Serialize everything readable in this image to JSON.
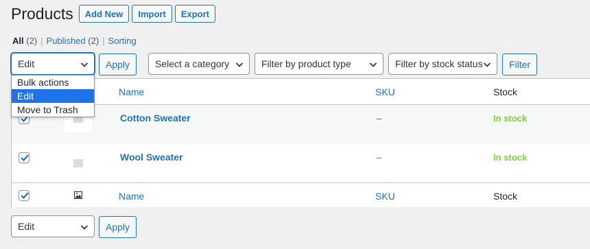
{
  "header": {
    "title": "Products",
    "buttons": [
      "Add New",
      "Import",
      "Export"
    ]
  },
  "views": [
    {
      "label": "All",
      "count": "(2)"
    },
    {
      "label": "Published",
      "count": "(2)"
    },
    {
      "label": "Sorting",
      "count": ""
    }
  ],
  "bulk": {
    "selected": "Edit",
    "options": [
      "Bulk actions",
      "Edit",
      "Move to Trash"
    ],
    "apply": "Apply"
  },
  "filters": {
    "category": "Select a category",
    "product_type": "Filter by product type",
    "stock_status": "Filter by stock status",
    "button": "Filter"
  },
  "table": {
    "columns": {
      "name": "Name",
      "sku": "SKU",
      "stock": "Stock"
    },
    "rows": [
      {
        "name": "Cotton Sweater",
        "sku": "–",
        "stock": "In stock"
      },
      {
        "name": "Wool Sweater",
        "sku": "–",
        "stock": "In stock"
      }
    ]
  },
  "bottom_bulk": {
    "selected": "Edit",
    "apply": "Apply"
  },
  "colors": {
    "accent": "#2271b1",
    "in_stock": "#7ad03a",
    "selected_option": "#1e73e8"
  }
}
